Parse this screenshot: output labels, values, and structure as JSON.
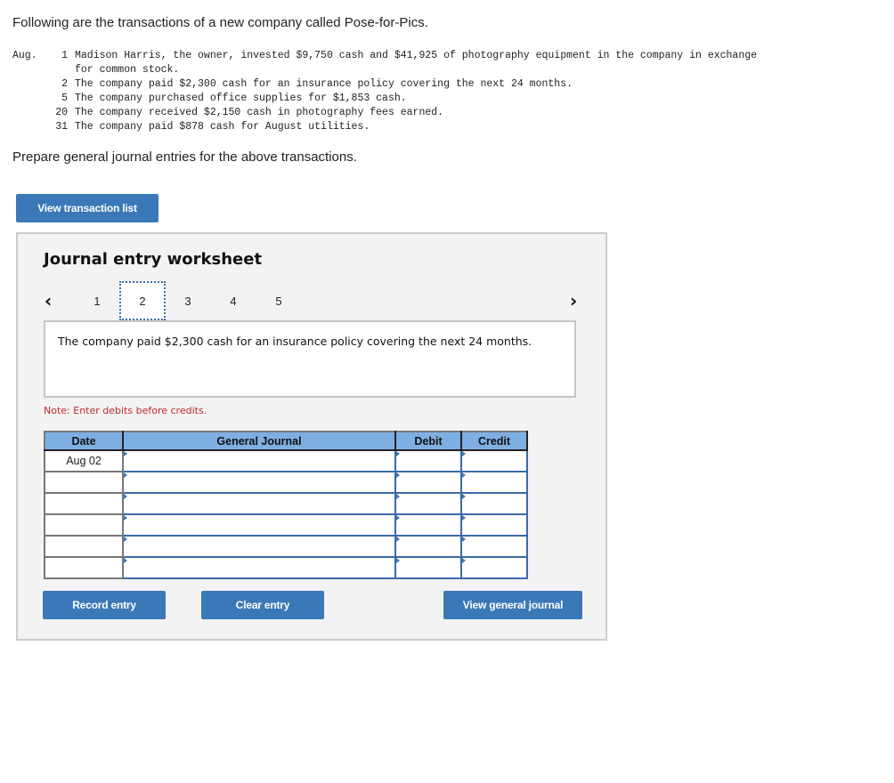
{
  "intro": "Following are the transactions of a new company called Pose-for-Pics.",
  "transactions": {
    "month": "Aug.",
    "items": [
      {
        "day": "1",
        "text": "Madison Harris, the owner, invested $9,750 cash and $41,925 of photography equipment in the company in exchange",
        "cont": "for common stock."
      },
      {
        "day": "2",
        "text": "The company paid $2,300 cash for an insurance policy covering the next 24 months."
      },
      {
        "day": "5",
        "text": "The company purchased office supplies for $1,853 cash."
      },
      {
        "day": "20",
        "text": "The company received $2,150 cash in photography fees earned."
      },
      {
        "day": "31",
        "text": "The company paid $878 cash for August utilities."
      }
    ]
  },
  "prepare": "Prepare general journal entries for the above transactions.",
  "buttons": {
    "view_transaction_list": "View transaction list",
    "record_entry": "Record entry",
    "clear_entry": "Clear entry",
    "view_general_journal": "View general journal"
  },
  "worksheet": {
    "title": "Journal entry worksheet",
    "pages": [
      "1",
      "2",
      "3",
      "4",
      "5"
    ],
    "active_page": "2",
    "prev_icon": "chevron-left",
    "next_icon": "chevron-right",
    "description": "The company paid $2,300 cash for an insurance policy covering the next 24 months.",
    "note": "Note: Enter debits before credits.",
    "table": {
      "headers": [
        "Date",
        "General Journal",
        "Debit",
        "Credit"
      ],
      "rows": [
        {
          "date": "Aug 02",
          "account": "",
          "debit": "",
          "credit": ""
        },
        {
          "date": "",
          "account": "",
          "debit": "",
          "credit": ""
        },
        {
          "date": "",
          "account": "",
          "debit": "",
          "credit": ""
        },
        {
          "date": "",
          "account": "",
          "debit": "",
          "credit": ""
        },
        {
          "date": "",
          "account": "",
          "debit": "",
          "credit": ""
        },
        {
          "date": "",
          "account": "",
          "debit": "",
          "credit": ""
        }
      ]
    }
  },
  "colors": {
    "button": "#3b78b8",
    "header": "#7eafe3",
    "note": "#c0282d"
  }
}
